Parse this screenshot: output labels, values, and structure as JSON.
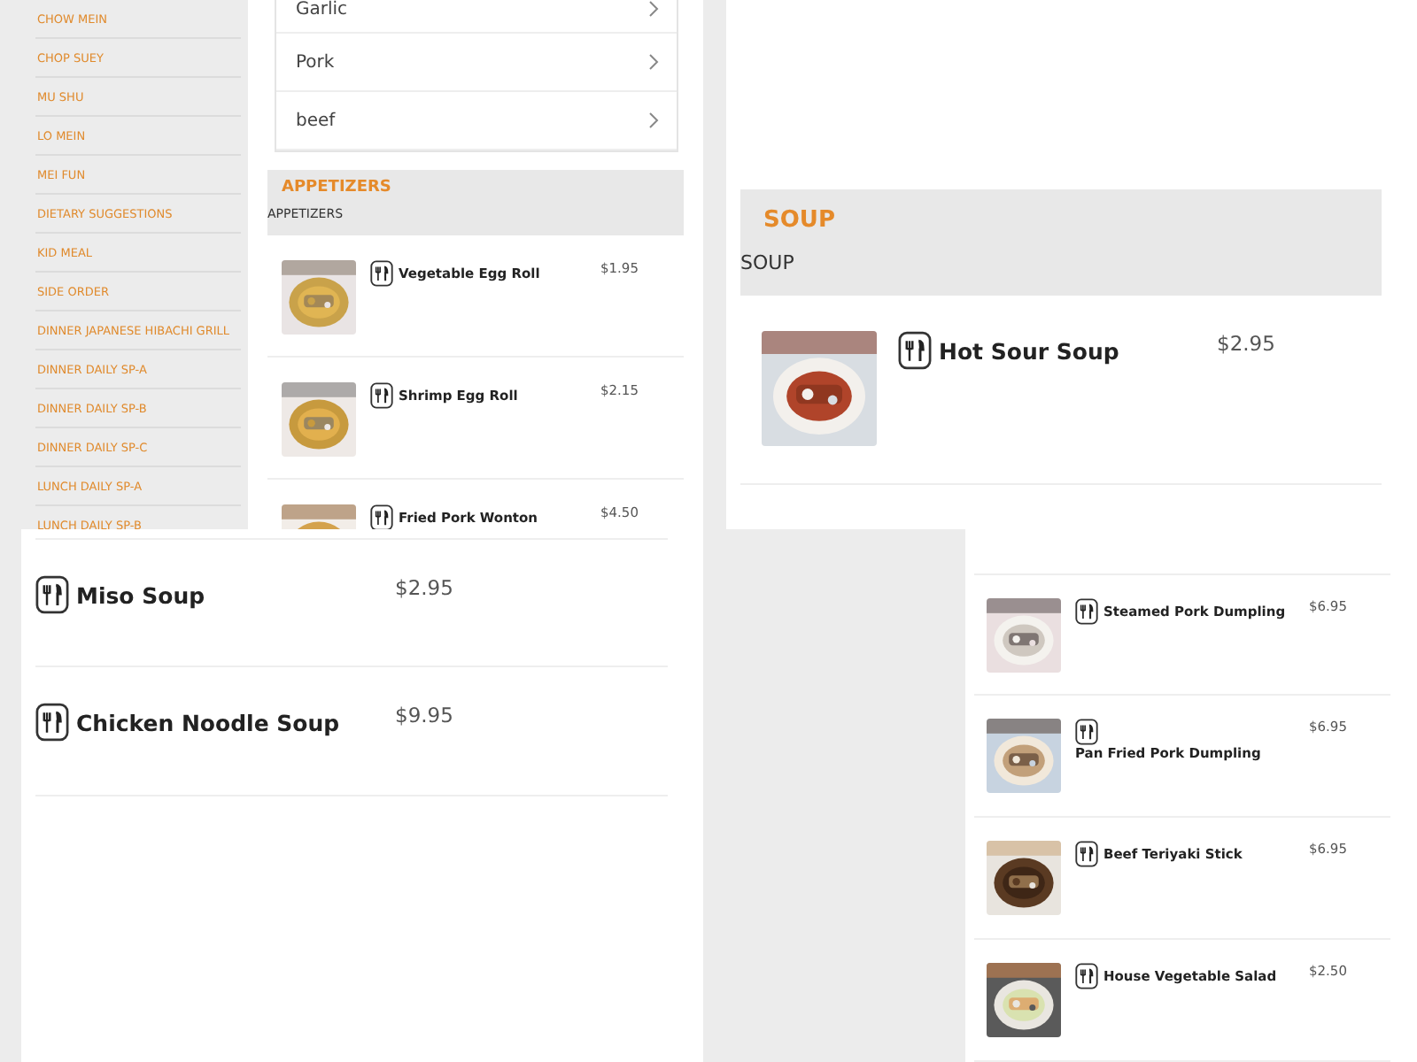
{
  "menu_panel": {
    "categories": [
      "CHOW MEIN",
      "CHOP SUEY",
      "MU SHU",
      "LO MEIN",
      "MEI FUN",
      "DIETARY SUGGESTIONS",
      "KID MEAL",
      "SIDE ORDER",
      "DINNER JAPANESE HIBACHI GRILL",
      "DINNER DAILY SP-A",
      "DINNER DAILY SP-B",
      "DINNER DAILY SP-C",
      "LUNCH DAILY SP-A",
      "LUNCH DAILY SP-B"
    ],
    "options": [
      "Garlic",
      "Pork",
      "beef"
    ],
    "section": {
      "title": "APPETIZERS",
      "subtitle": "APPETIZERS"
    },
    "items": [
      {
        "name": "Vegetable Egg Roll",
        "price": "$1.95"
      },
      {
        "name": "Shrimp Egg Roll",
        "price": "$2.15"
      },
      {
        "name": "Fried Pork Wonton",
        "price": "$4.50"
      }
    ]
  },
  "soup_panel": {
    "section": {
      "title": "SOUP",
      "subtitle": "SOUP"
    },
    "items": [
      {
        "name": "Hot Sour Soup",
        "price": "$2.95"
      }
    ]
  },
  "soup_list_panel": {
    "items": [
      {
        "name": "Miso Soup",
        "price": "$2.95"
      },
      {
        "name": "Chicken Noodle Soup",
        "price": "$9.95"
      }
    ]
  },
  "appetizer_list_panel": {
    "items": [
      {
        "name": "Steamed Pork Dumpling",
        "price": "$6.95"
      },
      {
        "name": "Pan Fried Pork Dumpling",
        "price": "$6.95"
      },
      {
        "name": "Beef Teriyaki Stick",
        "price": "$6.95"
      },
      {
        "name": "House Vegetable Salad",
        "price": "$2.50"
      }
    ]
  }
}
